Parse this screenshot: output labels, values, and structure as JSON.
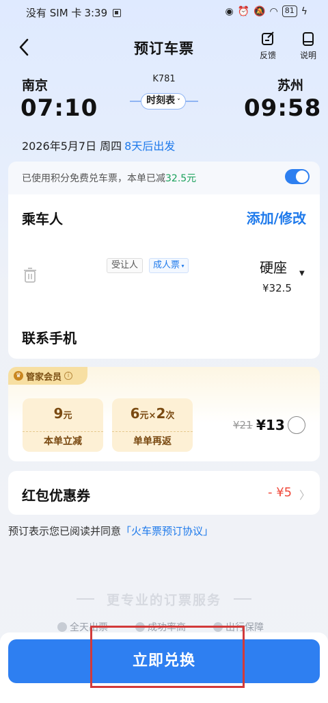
{
  "status_bar": {
    "carrier": "没有 SIM 卡",
    "time": "3:39",
    "battery": "81"
  },
  "header": {
    "title": "预订车票",
    "feedback_label": "反馈",
    "help_label": "说明"
  },
  "route": {
    "train_no": "K781",
    "from_city": "南京",
    "from_time": "07:10",
    "to_city": "苏州",
    "to_time": "09:58",
    "timetable_label": "时刻表",
    "date": "2026年5月7日 周四",
    "countdown": "8天后出发"
  },
  "points": {
    "text_prefix": "已使用积分免费兑车票，本单已减",
    "amount": "32.5元",
    "enabled": true
  },
  "passenger": {
    "title": "乘车人",
    "add_edit": "添加/修改",
    "name_tag": "受让人",
    "ticket_type": "成人票",
    "seat_type": "硬座",
    "seat_price": "¥32.5",
    "phone_label": "联系手机"
  },
  "member": {
    "tag": "管家会员",
    "coupon1_value": "9",
    "coupon1_unit": "元",
    "coupon1_label": "本单立减",
    "coupon2_value1": "6",
    "coupon2_unit1": "元",
    "coupon2_mult": "×",
    "coupon2_value2": "2",
    "coupon2_unit2": "次",
    "coupon2_label": "单单再返",
    "price_original": "¥21",
    "price_now": "¥13"
  },
  "red_packet": {
    "label": "红包优惠券",
    "value": "- ¥5"
  },
  "agreement": {
    "prefix": "预订表示您已阅读并同意",
    "link": "「火车票预订协议」"
  },
  "service": {
    "title": "更专业的订票服务",
    "items": [
      "全天出票",
      "成功率高",
      "出行保障"
    ]
  },
  "cta": {
    "label": "立即兑换"
  },
  "colors": {
    "accent": "#1f7aeb",
    "button": "#2e7ff1",
    "discount_red": "#f04a3c",
    "points_green": "#19a05a",
    "member_gold": "#f7dfa2"
  }
}
